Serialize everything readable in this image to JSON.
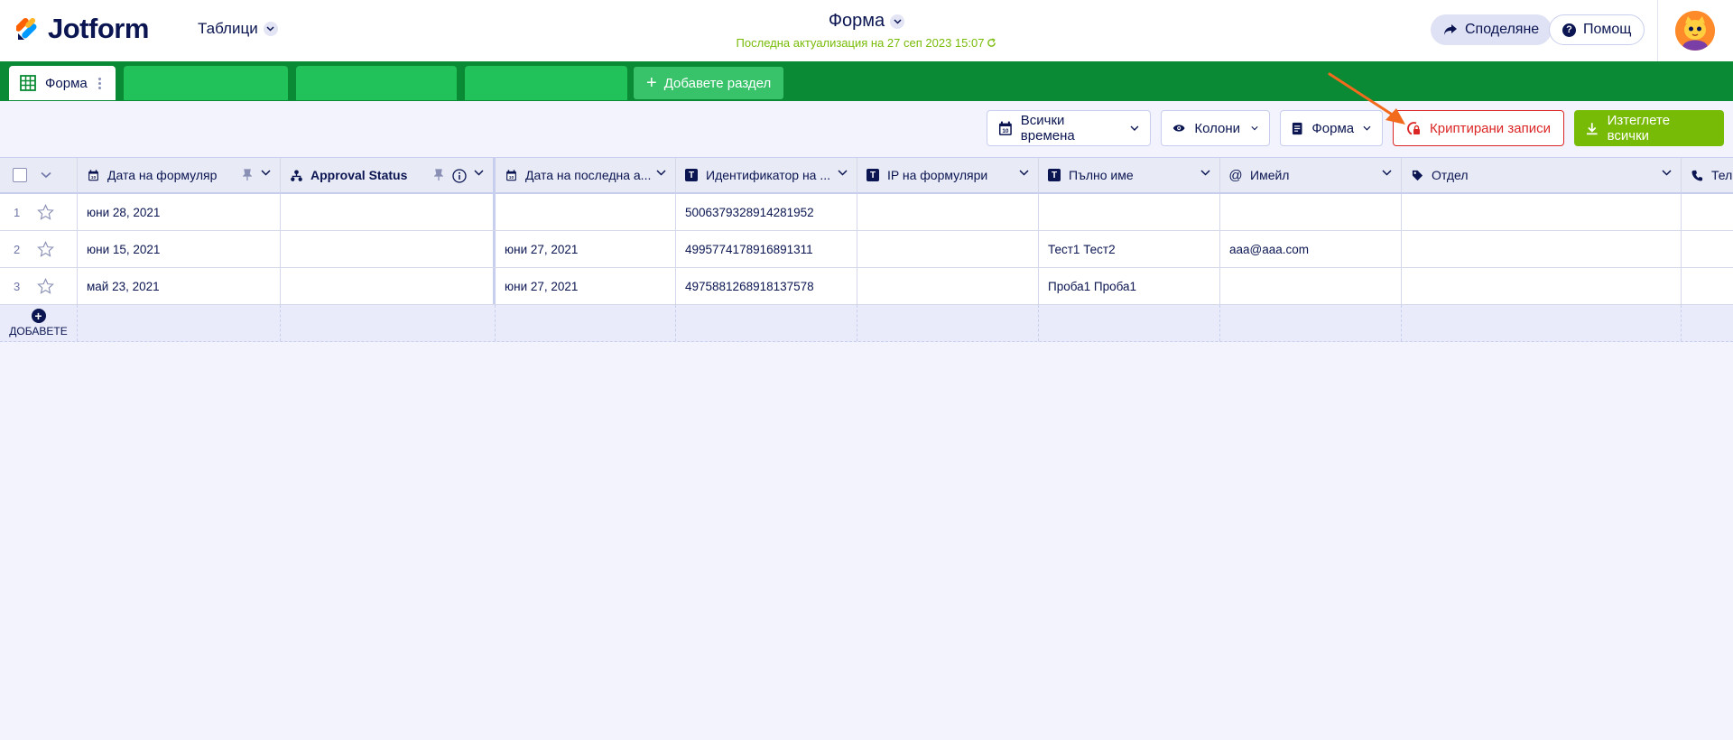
{
  "app": {
    "logo_text": "Jotform",
    "tables_menu_label": "Таблици",
    "form_title": "Форма",
    "last_updated": "Последна актуализация на 27 сеп 2023 15:07",
    "share_label": "Споделяне",
    "help_label": "Помощ"
  },
  "tabs": {
    "active_label": "Форма",
    "add_section_label": "Добавете раздел"
  },
  "toolbar": {
    "all_times_label": "Всички времена",
    "columns_label": "Колони",
    "form_view_label": "Форма",
    "encrypted_label": "Криптирани записи",
    "download_all_label": "Изтеглете всички"
  },
  "table": {
    "columns": [
      {
        "label": "Дата на формуляр",
        "icon": "calendar-icon"
      },
      {
        "label": "Approval Status",
        "icon": "hierarchy-icon"
      },
      {
        "label": "Дата на последна а...",
        "icon": "calendar-icon"
      },
      {
        "label": "Идентификатор на ...",
        "icon": "text-icon"
      },
      {
        "label": "IP на формуляри",
        "icon": "text-icon"
      },
      {
        "label": "Пълно име",
        "icon": "text-icon"
      },
      {
        "label": "Имейл",
        "icon": "at-icon"
      },
      {
        "label": "Отдел",
        "icon": "tag-icon"
      },
      {
        "label": "Тел",
        "icon": "phone-icon"
      }
    ],
    "rows": [
      {
        "num": "1",
        "cells": [
          "юни 28, 2021",
          "",
          "",
          "5006379328914281952",
          "",
          "",
          "",
          "",
          ""
        ]
      },
      {
        "num": "2",
        "cells": [
          "юни 15, 2021",
          "",
          "юни 27, 2021",
          "4995774178916891311",
          "",
          "Тест1 Тест2",
          "aaa@aaa.com",
          "",
          ""
        ]
      },
      {
        "num": "3",
        "cells": [
          "май 23, 2021",
          "",
          "юни 27, 2021",
          "4975881268918137578",
          "",
          "Проба1 Проба1",
          "",
          "",
          ""
        ]
      }
    ],
    "add_row_label": "ДОБАВЕТЕ"
  },
  "colors": {
    "brand_navy": "#0a1551",
    "tab_bar_green": "#0a8a34",
    "tab_green": "#22c25a",
    "download_green": "#78bb07",
    "encrypted_red": "#dc2626",
    "arrow_orange": "#f26b1d"
  }
}
